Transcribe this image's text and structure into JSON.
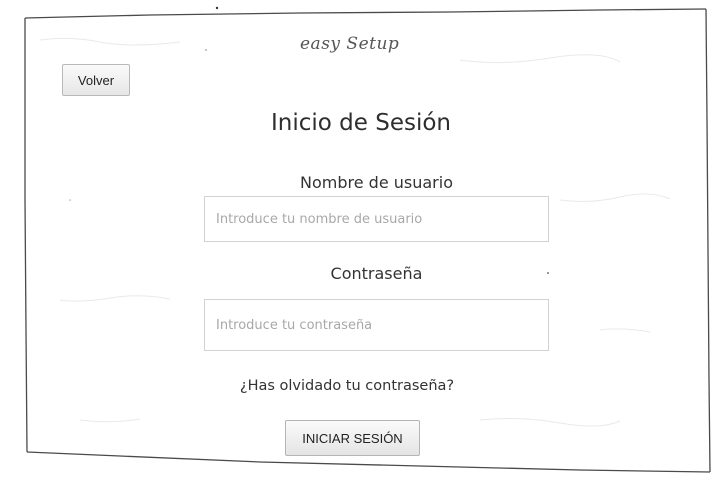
{
  "brand": {
    "name": "easy Setup"
  },
  "nav": {
    "back_label": "Volver"
  },
  "login": {
    "title": "Inicio de Sesión",
    "username": {
      "label": "Nombre de usuario",
      "value": "",
      "placeholder": "Introduce tu nombre de usuario"
    },
    "password": {
      "label": "Contraseña",
      "value": "",
      "placeholder": "Introduce tu contraseña"
    },
    "forgot_password_label": "¿Has olvidado tu contraseña?",
    "submit_label": "INICIAR SESIÓN"
  },
  "colors": {
    "background": "#ffffff",
    "frame_stroke": "#4a4a4a",
    "placeholder": "#a8a8a8",
    "input_border": "#d2d2d2"
  }
}
